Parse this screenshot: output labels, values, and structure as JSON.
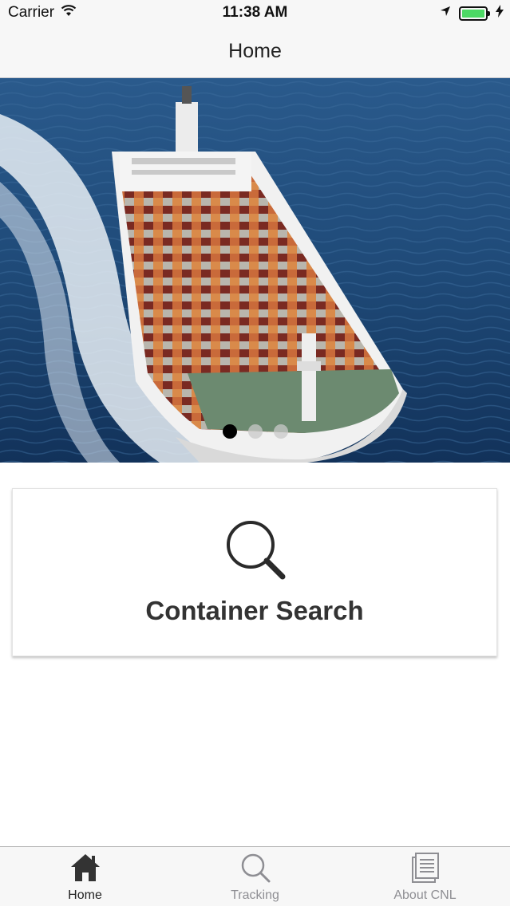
{
  "status_bar": {
    "carrier": "Carrier",
    "time": "11:38 AM",
    "battery_level": 1.0,
    "icons": [
      "wifi-icon",
      "location-arrow-icon",
      "battery-icon",
      "charging-bolt-icon"
    ]
  },
  "nav": {
    "title": "Home"
  },
  "carousel": {
    "image": "cargo-ship-photo",
    "page_count": 3,
    "current_page": 1
  },
  "card": {
    "icon": "search-icon",
    "title": "Container Search"
  },
  "tabs": [
    {
      "label": "Home",
      "icon": "home-icon",
      "active": true
    },
    {
      "label": "Tracking",
      "icon": "search-icon",
      "active": false
    },
    {
      "label": "About CNL",
      "icon": "document-icon",
      "active": false
    }
  ],
  "colors": {
    "battery_green": "#4cd964",
    "active_tab": "#222222",
    "inactive_tab": "#8e8e93",
    "sea": "#1f4a78"
  }
}
